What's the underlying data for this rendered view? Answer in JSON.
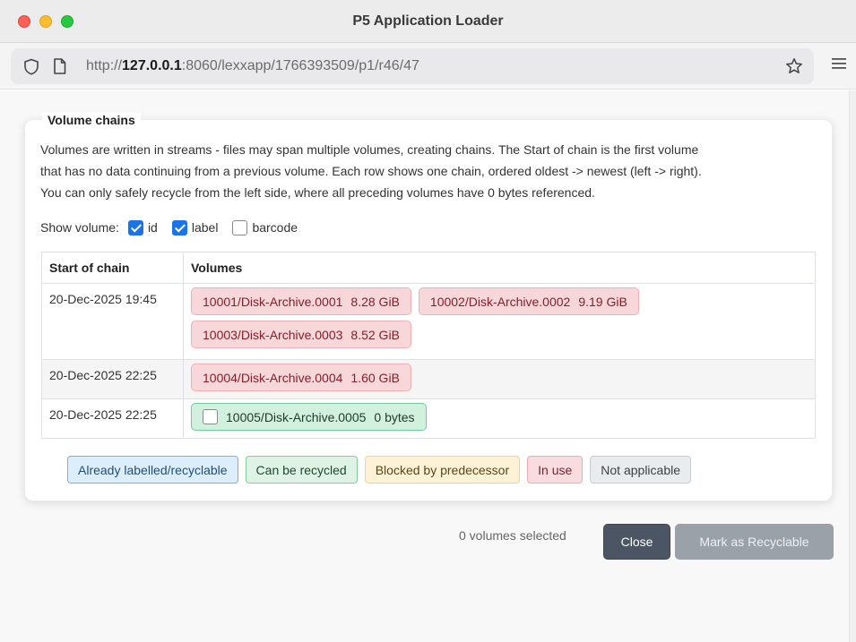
{
  "window": {
    "title": "P5 Application Loader"
  },
  "addressbar": {
    "url_prefix": "http://",
    "url_host": "127.0.0.1",
    "url_rest": ":8060/lexxapp/1766393509/p1/r46/47"
  },
  "panel": {
    "title": "Volume chains",
    "description_lines": [
      "Volumes are written in streams - files may span multiple volumes, creating chains. The Start of chain is the first volume",
      "that has no data continuing from a previous volume. Each row shows one chain, ordered oldest -> newest (left -> right).",
      "You can only safely recycle from the left side, where all preceding volumes have 0 bytes referenced."
    ],
    "show_volume": {
      "label": "Show volume:",
      "options": [
        {
          "label": "id",
          "checked": true
        },
        {
          "label": "label",
          "checked": true
        },
        {
          "label": "barcode",
          "checked": false
        }
      ]
    },
    "table": {
      "headers": [
        "Start of chain",
        "Volumes"
      ],
      "rows": [
        {
          "start": "20-Dec-2025 19:45",
          "volumes": [
            {
              "name": "10001/Disk-Archive.0001",
              "size": "8.28 GiB",
              "status": "in-use"
            },
            {
              "name": "10002/Disk-Archive.0002",
              "size": "9.19 GiB",
              "status": "in-use"
            },
            {
              "name": "10003/Disk-Archive.0003",
              "size": "8.52 GiB",
              "status": "in-use"
            }
          ]
        },
        {
          "start": "20-Dec-2025 22:25",
          "volumes": [
            {
              "name": "10004/Disk-Archive.0004",
              "size": "1.60 GiB",
              "status": "in-use"
            }
          ]
        },
        {
          "start": "20-Dec-2025 22:25",
          "volumes": [
            {
              "name": "10005/Disk-Archive.0005",
              "size": "0 bytes",
              "status": "can-recycle",
              "checked": false
            }
          ]
        }
      ]
    },
    "legend": [
      {
        "label": "Already labelled/recyclable",
        "kind": "labelled",
        "color": "#dceefc"
      },
      {
        "label": "Can be recycled",
        "kind": "can-recycle",
        "color": "#def3e6"
      },
      {
        "label": "Blocked by predecessor",
        "kind": "blocked",
        "color": "#fdf2d5"
      },
      {
        "label": "In use",
        "kind": "in-use",
        "color": "#f9dcdf"
      },
      {
        "label": "Not applicable",
        "kind": "na",
        "color": "#e9ecef"
      }
    ]
  },
  "footer": {
    "status": "0 volumes selected",
    "close_label": "Close",
    "recycle_label": "Mark as Recyclable"
  },
  "colors": {
    "close_button": "#4b5563",
    "recycle_button_disabled": "#9aa1a8",
    "checkbox_accent": "#1a73e8"
  }
}
